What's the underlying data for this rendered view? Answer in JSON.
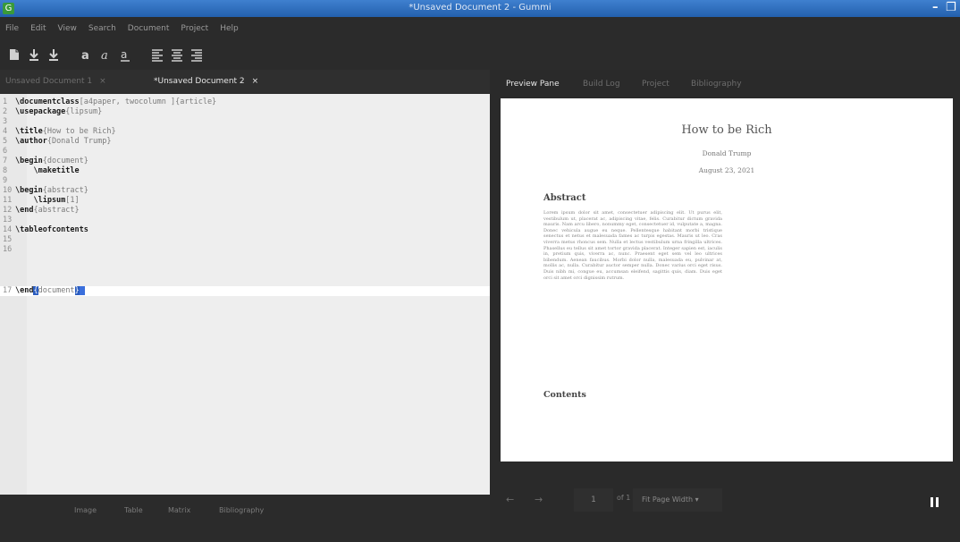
{
  "window": {
    "title": "*Unsaved Document 2 - Gummi",
    "app_icon": "gummi-icon",
    "controls": [
      "minimize-icon",
      "restore-icon"
    ]
  },
  "menu": [
    "File",
    "Edit",
    "View",
    "Search",
    "Document",
    "Project",
    "Help"
  ],
  "toolbar": [
    "new-document-icon",
    "download-icon",
    "download-alt-icon",
    "bold-icon",
    "italic-icon",
    "underline-icon",
    "align-left-icon",
    "align-center-icon",
    "align-right-icon"
  ],
  "editor": {
    "tabs": [
      {
        "label": "Unsaved Document 1",
        "close": "×"
      },
      {
        "label": "*Unsaved Document 2",
        "close": "×"
      }
    ],
    "line_numbers": [
      "1",
      "2",
      "3",
      "4",
      "5",
      "6",
      "7",
      "8",
      "9",
      "10",
      "11",
      "12",
      "13",
      "14",
      "15",
      "16",
      "17"
    ],
    "lines": [
      {
        "cmd": "\\documentclass",
        "rest": "[a4paper, twocolumn ]{article}"
      },
      {
        "cmd": "\\usepackage",
        "rest": "{lipsum}"
      },
      {
        "cmd": "",
        "rest": ""
      },
      {
        "cmd": "\\title",
        "rest": "{How to be Rich}"
      },
      {
        "cmd": "\\author",
        "rest": "{Donald Trump}"
      },
      {
        "cmd": "",
        "rest": ""
      },
      {
        "cmd": "\\begin",
        "rest": "{document}"
      },
      {
        "cmd": "    \\maketitle",
        "rest": ""
      },
      {
        "cmd": "",
        "rest": ""
      },
      {
        "cmd": "\\begin",
        "rest": "{abstract}"
      },
      {
        "cmd": "    \\lipsum",
        "rest": "[1]"
      },
      {
        "cmd": "\\end",
        "rest": "{abstract}"
      },
      {
        "cmd": "",
        "rest": ""
      },
      {
        "cmd": "\\tableofcontents",
        "rest": ""
      },
      {
        "cmd": "",
        "rest": ""
      },
      {
        "cmd": "",
        "rest": ""
      },
      {
        "cmd": "\\end",
        "rest": "document"
      }
    ],
    "current_line": "17",
    "bottom_buttons": [
      "Image",
      "Table",
      "Matrix",
      "Bibliography"
    ]
  },
  "preview": {
    "tabs": [
      "Preview Pane",
      "Build Log",
      "Project",
      "Bibliography"
    ],
    "document": {
      "title": "How to be Rich",
      "author": "Donald Trump",
      "date": "August 23, 2021",
      "abstract_heading": "Abstract",
      "abstract_text": "Lorem ipsum dolor sit amet, consectetuer adipiscing elit. Ut purus elit, vestibulum ut, placerat ac, adipiscing vitae, felis. Curabitur dictum gravida mauris. Nam arcu libero, nonummy eget, consectetuer id, vulputate a, magna. Donec vehicula augue eu neque. Pellentesque habitant morbi tristique senectus et netus et malesuada fames ac turpis egestas. Mauris ut leo. Cras viverra metus rhoncus sem. Nulla et lectus vestibulum urna fringilla ultrices. Phasellus eu tellus sit amet tortor gravida placerat. Integer sapien est, iaculis in, pretium quis, viverra ac, nunc. Praesent eget sem vel leo ultrices bibendum. Aenean faucibus. Morbi dolor nulla, malesuada eu, pulvinar at, mollis ac, nulla. Curabitur auctor semper nulla. Donec varius orci eget risus. Duis nibh mi, congue eu, accumsan eleifend, sagittis quis, diam. Duis eget orci sit amet orci dignissim rutrum.",
      "contents_heading": "Contents"
    },
    "nav": {
      "prev": "←",
      "next": "→",
      "page": "1",
      "of_pages": "of 1",
      "zoom": "Fit Page Width ▾",
      "pause": "pause-icon"
    }
  }
}
